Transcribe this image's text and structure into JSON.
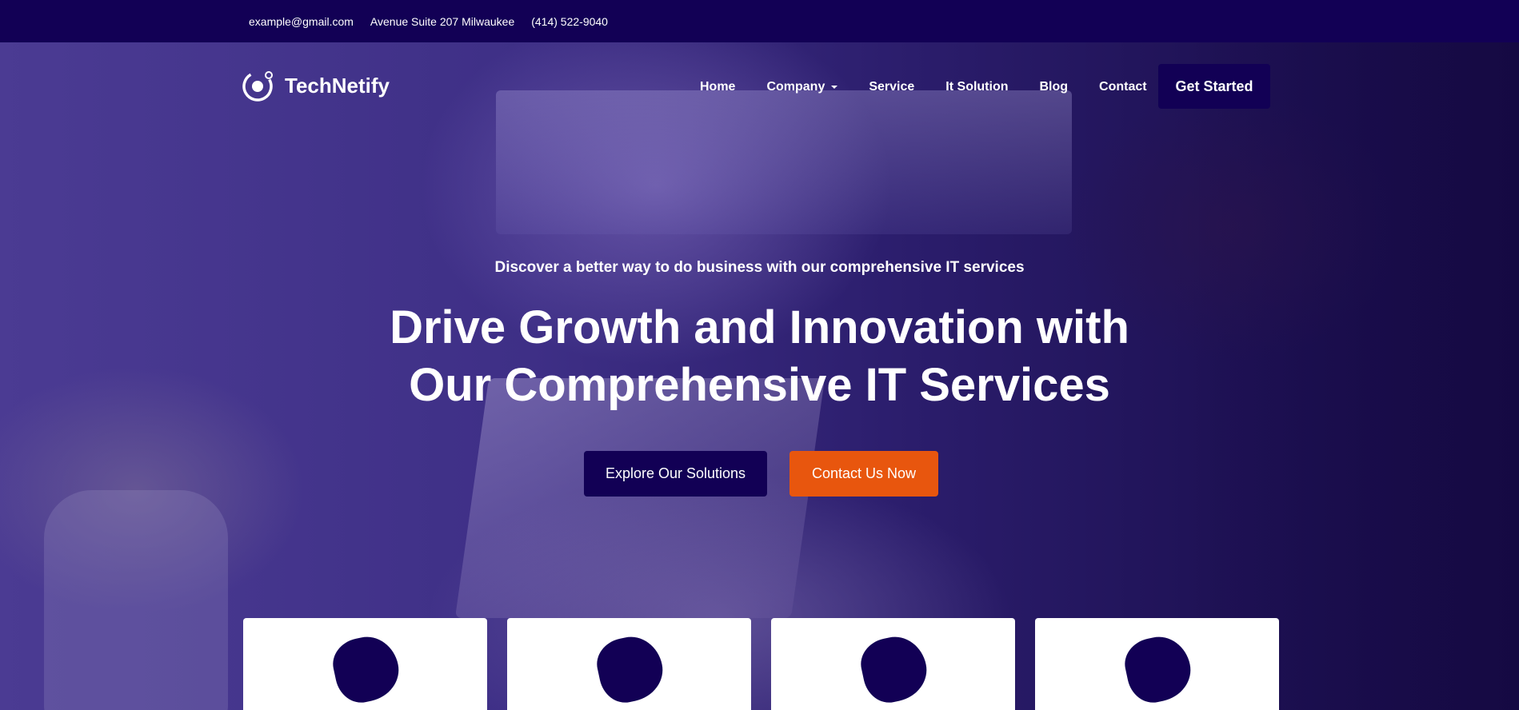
{
  "topbar": {
    "email": "example@gmail.com",
    "address": "Avenue Suite 207 Milwaukee",
    "phone": "(414) 522-9040"
  },
  "brand": {
    "name": "TechNetify",
    "logo_icon": "target-ring-icon"
  },
  "nav": {
    "items": [
      {
        "label": "Home"
      },
      {
        "label": "Company",
        "has_dropdown": true
      },
      {
        "label": "Service"
      },
      {
        "label": "It Solution"
      },
      {
        "label": "Blog"
      },
      {
        "label": "Contact"
      }
    ],
    "cta_label": "Get Started"
  },
  "hero": {
    "subtitle": "Discover a better way to do business with our comprehensive IT services",
    "title_line1": "Drive Growth and Innovation with",
    "title_line2": "Our Comprehensive IT Services",
    "primary_button": "Explore Our Solutions",
    "secondary_button": "Contact Us Now"
  },
  "colors": {
    "primary": "#120055",
    "accent": "#e8560e",
    "text_light": "#ffffff"
  },
  "service_cards": [
    {
      "icon": "blob-shape-icon"
    },
    {
      "icon": "blob-shape-icon"
    },
    {
      "icon": "blob-shape-icon"
    },
    {
      "icon": "blob-shape-icon"
    }
  ]
}
